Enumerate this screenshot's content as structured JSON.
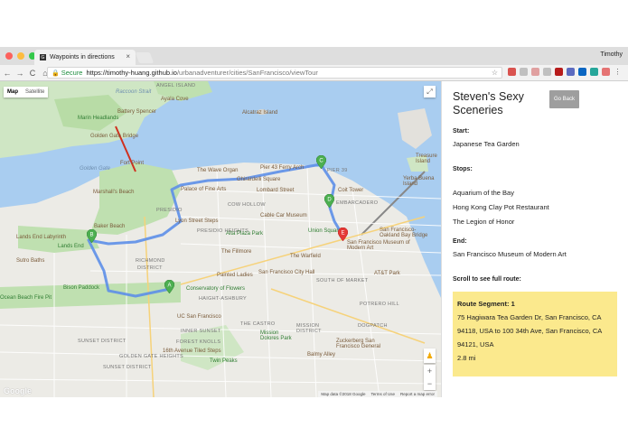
{
  "browser": {
    "tab_title": "Waypoints in directions",
    "tab_close": "×",
    "profile_name": "Timothy",
    "secure_label": "Secure",
    "url_host": "https://timothy-huang.github.io",
    "url_path": "/urbanadventurer/cities/SanFrancisco/viewTour",
    "nav": {
      "back": "←",
      "forward": "→",
      "reload": "C",
      "home": "⌂"
    },
    "star": "☆"
  },
  "map": {
    "type_control": {
      "map": "Map",
      "satellite": "Satellite"
    },
    "fullscreen": "⤢",
    "pegman": "♟",
    "zoom_in": "+",
    "zoom_out": "−",
    "google_logo": "Google",
    "attribution": [
      "Map data ©2018 Google",
      "Terms of Use",
      "Report a map error"
    ],
    "labels": {
      "angel_island": "ANGEL ISLAND",
      "raccoon_strait": "Raccoon Strait",
      "ayala_cove": "Ayala Cove",
      "battery_spencer": "Battery Spencer",
      "headlands": "Marin Headlands",
      "alcatraz": "Alcatraz Island",
      "golden_gate_bridge": "Golden Gate Bridge",
      "golden_gate": "Golden Gate",
      "fort_point": "Fort Point",
      "marshalls_beach": "Marshall's Beach",
      "baker_beach": "Baker Beach",
      "lands_end_labyrinth": "Lands End Labyrinth",
      "lands_end": "Lands End",
      "sutro_baths": "Sutro Baths",
      "bison_paddock": "Bison Paddock",
      "ocean_beach": "Ocean Beach Fire Pit",
      "wave_organ": "The Wave Organ",
      "pier43": "Pier 43 Ferry Arch",
      "pier39": "PIER 39",
      "palace": "Palace of Fine Arts",
      "ghirardelli": "Ghirardelli Square",
      "lombard": "Lombard Street",
      "coit": "Coit Tower",
      "embarcadero": "EMBARCADERO",
      "cow_hollow": "COW HOLLOW",
      "presidio": "PRESIDIO",
      "lyon_steps": "Lyon Street Steps",
      "cable_car": "Cable Car Museum",
      "alta_plaza": "Alta Plaza Park",
      "union_square": "Union Square",
      "fillmore": "The Fillmore",
      "warfield": "The Warfield",
      "sfmoma": "San Francisco Museum of Modern Art",
      "city_hall": "San Francisco City Hall",
      "painted_ladies": "Painted Ladies",
      "conservatory": "Conservatory of Flowers",
      "richmond": "RICHMOND",
      "richmond_district": "DISTRICT",
      "haight": "HAIGHT-ASHBURY",
      "soma": "SOUTH OF MARKET",
      "ucsf": "UC San Francisco",
      "castro": "THE CASTRO",
      "mission_dolores": "Mission Dolores Park",
      "mission": "MISSION DISTRICT",
      "sunset": "SUNSET DISTRICT",
      "sunset2": "SUNSET DISTRICT",
      "inner_sunset": "INNER SUNSET",
      "forest_knolls": "FOREST KNOLLS",
      "golden_gate_heights": "GOLDEN GATE HEIGHTS",
      "tiled_steps": "16th Avenue Tiled Steps",
      "twin_peaks": "Twin Peaks",
      "yerba_buena": "Yerba Buena Island",
      "treasure": "Treasure Island",
      "bay_bridge": "San Francisco-Oakland Bay Bridge",
      "att_park": "AT&T Park",
      "dogpatch": "DOGPATCH",
      "zuckerberg": "Zuckerberg San Francisco General",
      "balmy": "Balmy Alley",
      "potrero": "POTRERO HILL",
      "presidio_heights": "PRESIDIO HEIGHTS"
    },
    "markers": [
      {
        "letter": "A",
        "color": "#4caf50"
      },
      {
        "letter": "B",
        "color": "#4caf50"
      },
      {
        "letter": "C",
        "color": "#4caf50"
      },
      {
        "letter": "D",
        "color": "#4caf50"
      },
      {
        "letter": "E",
        "color": "#e53935"
      }
    ],
    "colors": {
      "water": "#a9cdf0",
      "park": "#bfe0b0",
      "route": "#5d8fe8",
      "land": "#ecebe6"
    }
  },
  "panel": {
    "title": "Steven's Sexy Sceneries",
    "go_back": "Go Back",
    "start_heading": "Start:",
    "start_value": "Japanese Tea Garden",
    "stops_heading": "Stops:",
    "stops": [
      "Aquarium of the Bay",
      "Hong Kong Clay Pot Restaurant",
      "The Legion of Honor"
    ],
    "end_heading": "End:",
    "end_value": "San Francisco Museum of Modern Art",
    "scroll_hint": "Scroll to see full route:",
    "segment": {
      "heading": "Route Segment: 1",
      "from": "75 Hagiwara Tea Garden Dr, San Francisco, CA 94118, USA to 100 34th Ave, San Francisco, CA 94121, USA",
      "distance": "2.8 mi"
    }
  }
}
